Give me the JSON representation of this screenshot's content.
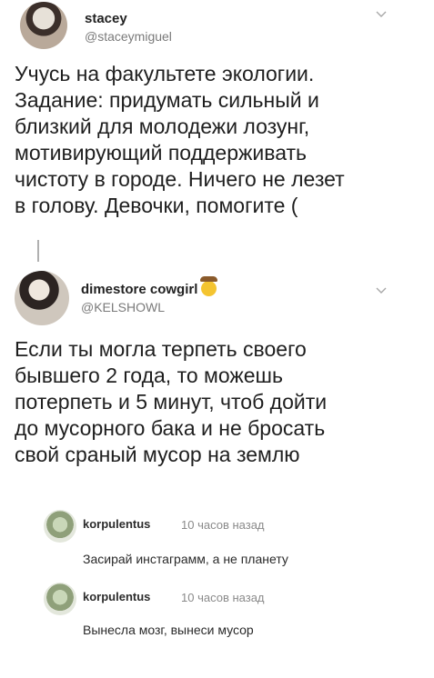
{
  "tweet1": {
    "name": "stacey",
    "handle": "@staceymiguel",
    "text": "Учусь на факультете экологии.\nЗадание: придумать сильный и\nблизкий для молодежи лозунг,\nмотивирующий поддерживать\nчистоту в городе. Ничего не лезет\nв голову. Девочки, помогите ("
  },
  "tweet2": {
    "name": "dimestore cowgirl",
    "handle": "@KELSHOWL",
    "emoji_icon": "cowboy-face-icon",
    "text": "Если ты могла терпеть своего\nбывшего 2 года, то можешь\nпотерпеть и 5 минут, чтоб дойти\nдо мусорного бака и не бросать\nсвой сраный мусор на землю"
  },
  "comments": [
    {
      "name": "korpulentus",
      "time": "10 часов назад",
      "text": "Засирай инстаграмм, а не планету"
    },
    {
      "name": "korpulentus",
      "time": "10 часов назад",
      "text": "Вынесла мозг, вынеси мусор"
    }
  ],
  "colors": {
    "handle": "#7a7a7a",
    "text": "#1f1f1f",
    "time": "#8a8a8a"
  }
}
